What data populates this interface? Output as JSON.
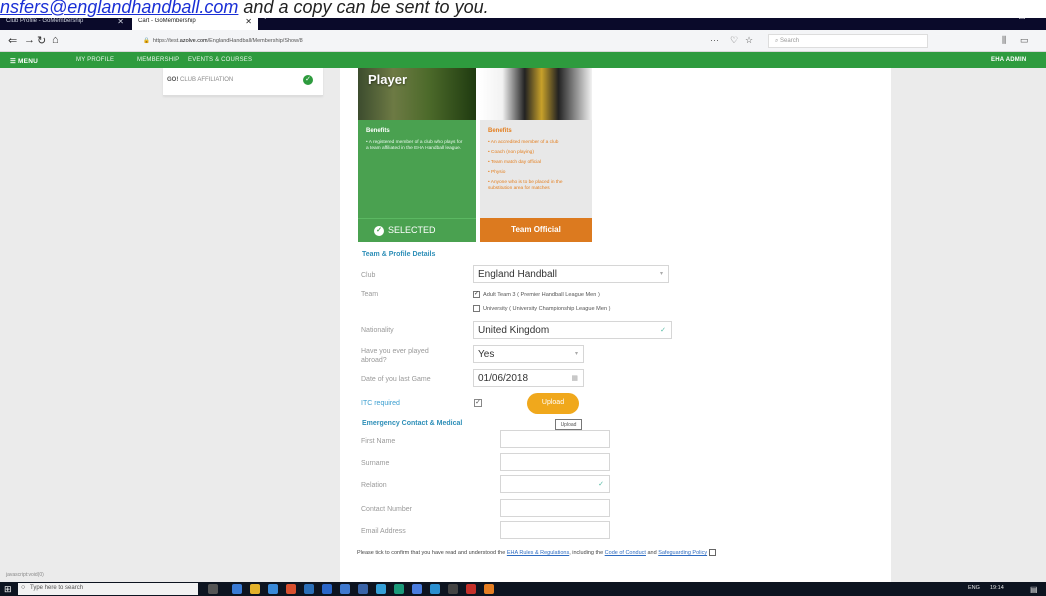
{
  "doc_overlay": {
    "link": "nsfers@englandhandball.com",
    "rest": " and a copy can be sent to you."
  },
  "browser": {
    "tabs": [
      {
        "label": "Club Profile - GoMembership"
      },
      {
        "label": "Cart - GoMembership"
      }
    ],
    "url_prefix": "https://test.",
    "url_host": "azolve.com",
    "url_rest": "/EnglandHandball/Membership/Show/8",
    "search_placeholder": "Search"
  },
  "navbar": {
    "menu_label": "MENU",
    "items": [
      "MY PROFILE",
      "MEMBERSHIP",
      "EVENTS & COURSES"
    ],
    "user_label": "EHA ADMIN"
  },
  "affiliation": {
    "prefix": "GO!",
    "label": "CLUB AFFILIATION"
  },
  "cards": {
    "player": {
      "title": "Player",
      "benefits_title": "Benefits",
      "benefits": [
        "• A registered member of a club who plays for a team affiliated in the EHA Handball league."
      ],
      "status_label": "SELECTED"
    },
    "official": {
      "benefits_title": "Benefits",
      "benefits": [
        "• An accredited member of a club",
        "• Coach (non playing)",
        "• Team match day official",
        "• Physio",
        "• Anyone who is to be placed in the substitution area for matches"
      ],
      "button_label": "Team Official"
    }
  },
  "form": {
    "section_team": "Team & Profile Details",
    "club_label": "Club",
    "club_value": "England Handball",
    "team_label": "Team",
    "team_options": [
      {
        "label": "Adult Team 3 ( Premier Handball League Men )",
        "checked": true
      },
      {
        "label": "University ( University Championship League Men )",
        "checked": false
      }
    ],
    "nationality_label": "Nationality",
    "nationality_value": "United Kingdom",
    "played_abroad_label": "Have you ever played abroad?",
    "played_abroad_value": "Yes",
    "last_game_label": "Date of you last Game",
    "last_game_value": "01/06/2018",
    "itc_label": "ITC required",
    "upload_label": "Upload",
    "upload_tooltip": "Upload",
    "section_emergency": "Emergency Contact & Medical",
    "first_name_label": "First Name",
    "surname_label": "Surname",
    "relation_label": "Relation",
    "contact_number_label": "Contact Number",
    "email_label": "Email Address",
    "consent_text_1": "Please tick to confirm that you have read and understood the ",
    "consent_link_1": "EHA Rules & Regulations",
    "consent_text_2": ", including the ",
    "consent_link_2": "Code of Conduct",
    "consent_text_3": " and ",
    "consent_link_3": "Safeguarding Policy"
  },
  "status_text": "javascript:void(0)",
  "taskbar": {
    "search_placeholder": "Type here to search",
    "time": "19:14",
    "lang": "ENG"
  }
}
